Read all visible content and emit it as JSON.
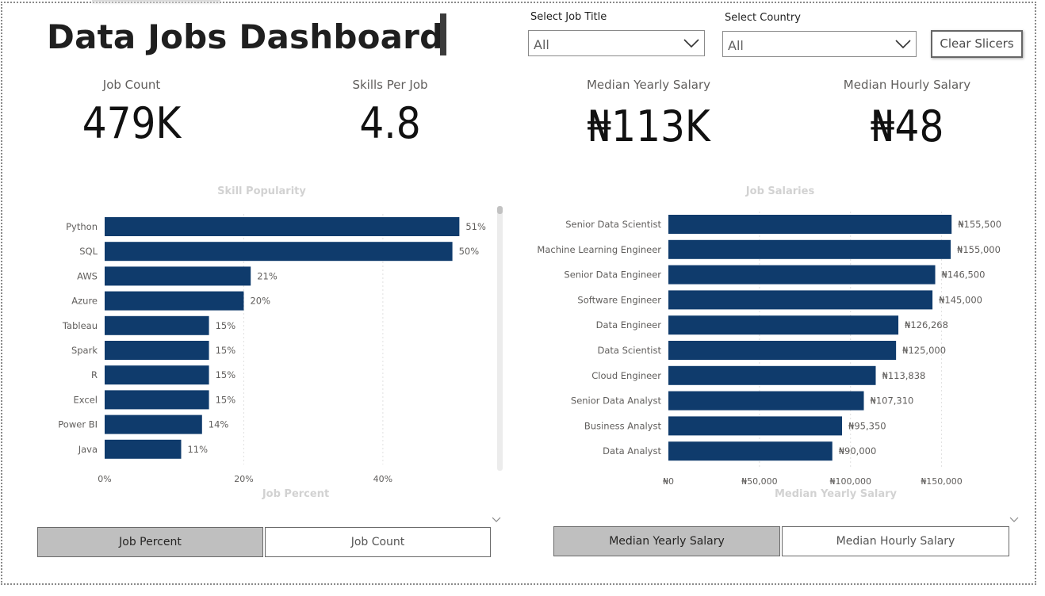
{
  "dashboard": {
    "title": "Data Jobs Dashboard"
  },
  "slicers": {
    "job_title": {
      "label": "Select Job Title",
      "value": "All"
    },
    "country": {
      "label": "Select Country",
      "value": "All"
    },
    "clear_label": "Clear Slicers"
  },
  "kpis": [
    {
      "label": "Job Count",
      "value": "479K"
    },
    {
      "label": "Skills Per Job",
      "value": "4.8"
    },
    {
      "label": "Median Yearly Salary",
      "value": "₦113K"
    },
    {
      "label": "Median Hourly Salary",
      "value": "₦48"
    }
  ],
  "toggles": {
    "left": [
      {
        "label": "Job Percent",
        "active": true
      },
      {
        "label": "Job Count",
        "active": false
      }
    ],
    "right": [
      {
        "label": "Median Yearly Salary",
        "active": true
      },
      {
        "label": "Median Hourly Salary",
        "active": false
      }
    ]
  },
  "colors": {
    "bar": "#0f3b6c",
    "faint_text": "#d2d2d2",
    "grid": "#e0e0e0"
  },
  "chart_data": [
    {
      "type": "bar",
      "orientation": "horizontal",
      "title": "Skill Popularity",
      "xlabel": "Job Percent",
      "ylabel": "",
      "categories": [
        "Python",
        "SQL",
        "AWS",
        "Azure",
        "Tableau",
        "Spark",
        "R",
        "Excel",
        "Power BI",
        "Java"
      ],
      "values": [
        0.51,
        0.5,
        0.21,
        0.2,
        0.15,
        0.15,
        0.15,
        0.15,
        0.14,
        0.11
      ],
      "data_labels": [
        "51%",
        "50%",
        "21%",
        "20%",
        "15%",
        "15%",
        "15%",
        "15%",
        "14%",
        "11%"
      ],
      "x_ticks": [
        0,
        0.2,
        0.4
      ],
      "x_tick_labels": [
        "0%",
        "20%",
        "40%"
      ],
      "xlim": [
        0,
        0.57
      ],
      "grid": true
    },
    {
      "type": "bar",
      "orientation": "horizontal",
      "title": "Job Salaries",
      "xlabel": "Median Yearly Salary",
      "ylabel": "",
      "categories": [
        "Senior Data Scientist",
        "Machine Learning Engineer",
        "Senior Data Engineer",
        "Software Engineer",
        "Data Engineer",
        "Data Scientist",
        "Cloud Engineer",
        "Senior Data Analyst",
        "Business Analyst",
        "Data Analyst"
      ],
      "values": [
        155500,
        155000,
        146500,
        145000,
        126268,
        125000,
        113838,
        107310,
        95350,
        90000
      ],
      "data_labels": [
        "₦155,500",
        "₦155,000",
        "₦146,500",
        "₦145,000",
        "₦126,268",
        "₦125,000",
        "₦113,838",
        "₦107,310",
        "₦95,350",
        "₦90,000"
      ],
      "x_ticks": [
        0,
        50000,
        100000,
        150000
      ],
      "x_tick_labels": [
        "₦0",
        "₦50,000",
        "₦100,000",
        "₦150,000"
      ],
      "xlim": [
        0,
        175000
      ],
      "grid": true
    }
  ]
}
